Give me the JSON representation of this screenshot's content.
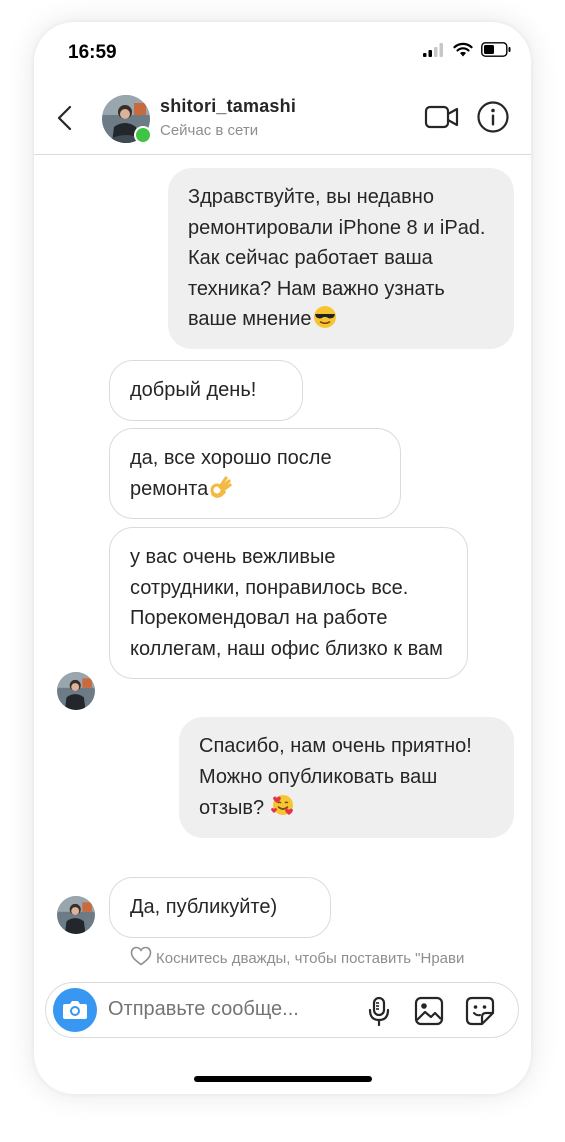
{
  "status_bar": {
    "time": "16:59"
  },
  "header": {
    "username": "shitori_tamashi",
    "status": "Сейчас в сети"
  },
  "messages": [
    {
      "side": "out",
      "text": "Здравствуйте, вы недавно ремонтировали iPhone 8 и iPad. Как сейчас работает ваша техника? Нам важно узнать ваше мнение",
      "emoji": "sunglasses"
    },
    {
      "side": "in",
      "text": "добрый день!"
    },
    {
      "side": "in",
      "text": "да, все хорошо после ремонта",
      "emoji": "ok-hand"
    },
    {
      "side": "in",
      "text": "у вас очень вежливые сотрудники, понравилось все. Порекомендовал на работе коллегам, наш офис близко к вам"
    },
    {
      "side": "out",
      "text": "Спасибо, нам очень приятно! Можно опубликовать ваш отзыв?",
      "emoji": "smiling-face-with-hearts"
    },
    {
      "side": "in",
      "text": "Да, публикуйте)"
    }
  ],
  "like_hint": "Коснитесь дважды, чтобы поставить \"Нрави",
  "composer": {
    "placeholder": "Отправьте сообще..."
  },
  "icons": [
    "back-chevron-icon",
    "video-call-icon",
    "info-icon",
    "heart-icon",
    "camera-icon",
    "microphone-icon",
    "gallery-icon",
    "sticker-icon"
  ],
  "colors": {
    "accent": "#3897f0",
    "online": "#3ec343",
    "bubble_out": "#efefef",
    "border": "#dbdbdb",
    "muted": "#8e8e8e"
  }
}
